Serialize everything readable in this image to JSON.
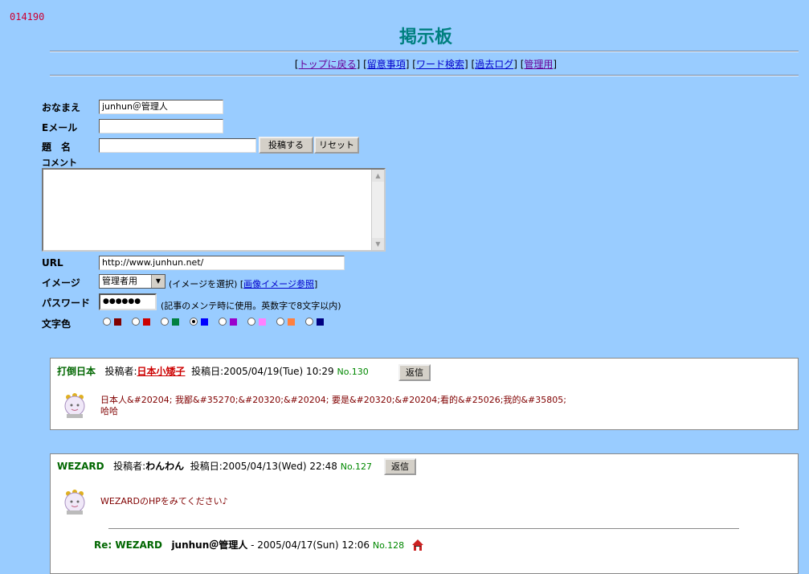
{
  "counter": "014190",
  "title": "掲示板",
  "nav": {
    "open": "[",
    "items": [
      "トップに戻る",
      "留意事項",
      "ワード検索",
      "過去ログ",
      "管理用"
    ],
    "sep": "] [",
    "close": "]"
  },
  "form": {
    "name_label": "おなまえ",
    "name_value": "junhun＠管理人",
    "email_label": "Eメール",
    "email_value": "",
    "subject_label": "題　名",
    "subject_value": "",
    "submit_label": "投稿する",
    "reset_label": "リセット",
    "comment_label": "コメント",
    "url_label": "URL",
    "url_value": "http://www.junhun.net/",
    "image_label": "イメージ",
    "image_selected": "管理者用",
    "image_hint": "(イメージを選択)",
    "image_link_open": "[",
    "image_link": "画像イメージ参照",
    "image_link_close": "]",
    "password_label": "パスワード",
    "password_value": "●●●●●●",
    "password_hint": "(記事のメンテ時に使用。英数字で8文字以内)",
    "color_label": "文字色",
    "colors": [
      "#800000",
      "#cc0000",
      "#008040",
      "#0000ff",
      "#9900cc",
      "#ff80ff",
      "#ff8040",
      "#000080"
    ],
    "selected_color_index": 3
  },
  "posts": [
    {
      "subject": "打倒日本",
      "author_label": "投稿者:",
      "author": "日本小矮子",
      "date_label": "投稿日:",
      "date": "2005/04/19(Tue) 10:29",
      "no": "No.130",
      "reply_label": "返信",
      "body_line1": "日本人&#20204; 我鄙&#35270;&#20320;&#20204; 要是&#20320;&#20204;看的&#25026;我的&#35805;",
      "body_line2": "哈哈"
    },
    {
      "subject": "WEZARD",
      "author_label": "投稿者:",
      "author": "わんわん",
      "date_label": "投稿日:",
      "date": "2005/04/13(Wed) 22:48",
      "no": "No.127",
      "reply_label": "返信",
      "body_line1": "WEZARDのHPをみてください♪",
      "reply": {
        "prefix": "Re: WEZARD",
        "author": "junhun＠管理人",
        "date": "- 2005/04/17(Sun) 12:06",
        "no": "No.128"
      }
    }
  ]
}
